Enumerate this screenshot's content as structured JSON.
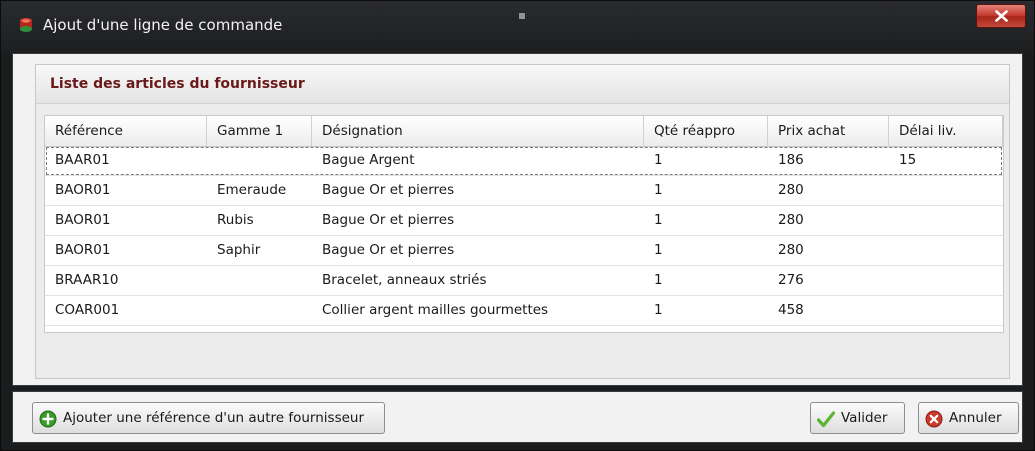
{
  "window": {
    "title": "Ajout d'une ligne de commande",
    "icons": {
      "app": "app-logo-icon",
      "close": "close-icon"
    }
  },
  "group": {
    "title": "Liste des articles du fournisseur"
  },
  "table": {
    "columns": [
      "Référence",
      "Gamme 1",
      "Désignation",
      "Qté réappro",
      "Prix achat",
      "Délai liv."
    ],
    "rows": [
      [
        "BAAR01",
        "",
        "Bague Argent",
        "1",
        "186",
        "15"
      ],
      [
        "BAOR01",
        "Emeraude",
        "Bague Or et pierres",
        "1",
        "280",
        ""
      ],
      [
        "BAOR01",
        "Rubis",
        "Bague Or et pierres",
        "1",
        "280",
        ""
      ],
      [
        "BAOR01",
        "Saphir",
        "Bague Or et pierres",
        "1",
        "280",
        ""
      ],
      [
        "BRAAR10",
        "",
        "Bracelet, anneaux striés",
        "1",
        "276",
        ""
      ],
      [
        "COAR001",
        "",
        "Collier argent mailles gourmettes",
        "1",
        "458",
        ""
      ]
    ],
    "selected_row": 0
  },
  "footer": {
    "add_label": "Ajouter une référence d'un autre fournisseur",
    "ok_label": "Valider",
    "cancel_label": "Annuler",
    "icons": {
      "add": "add-circle-icon",
      "ok": "checkmark-icon",
      "cancel": "cancel-circle-icon"
    }
  },
  "colors": {
    "title_bar": "#1d1e20",
    "group_title": "#6b1818",
    "close_button": "#c2352a",
    "add_icon": "#3a9a2a",
    "ok_icon": "#5bb533",
    "cancel_icon": "#c93a2d"
  }
}
